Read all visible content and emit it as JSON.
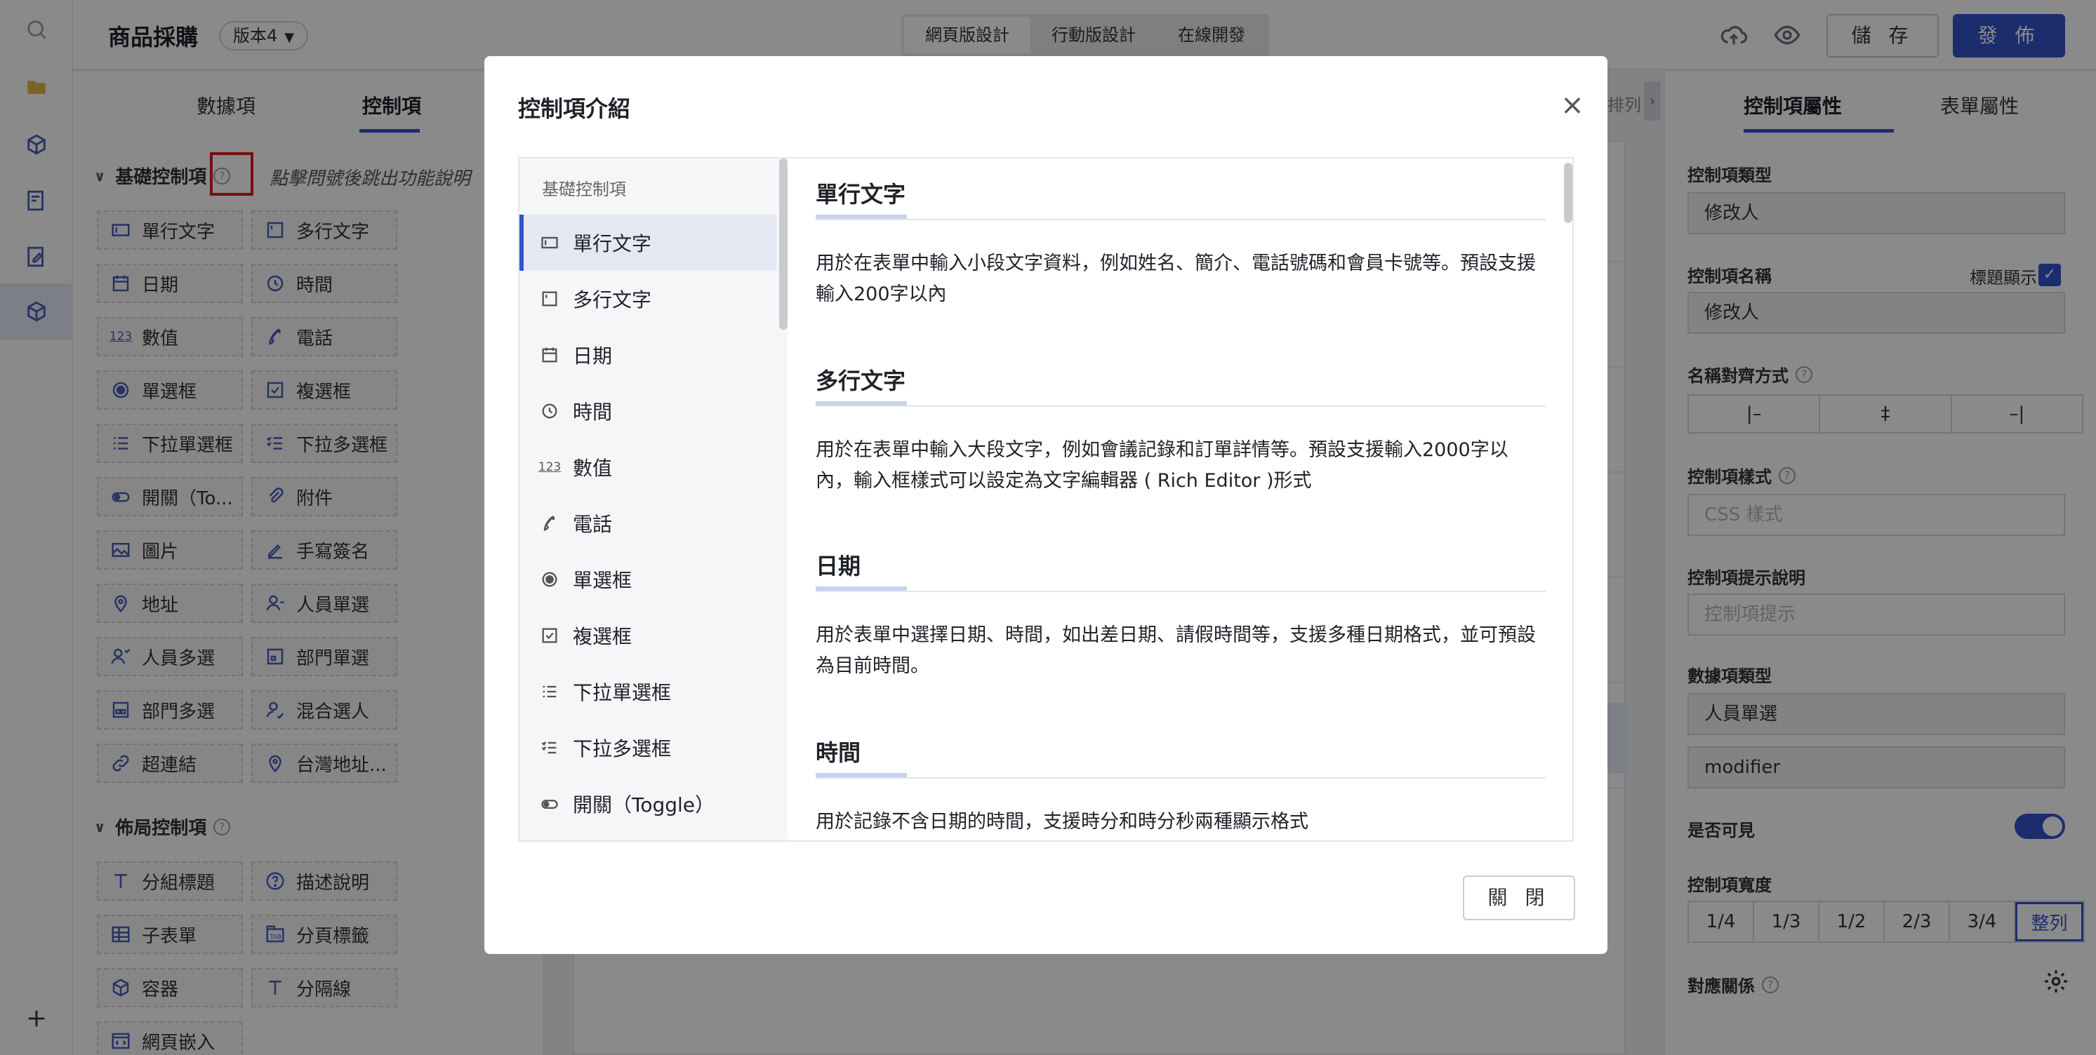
{
  "app": {
    "title": "商品採購",
    "version": "版本4",
    "modes": [
      "網頁版設計",
      "行動版設計",
      "在線開發"
    ],
    "save_label": "儲 存",
    "publish_label": "發 佈"
  },
  "left_panel": {
    "tabs": [
      "數據項",
      "控制項"
    ],
    "basic_header": "基礎控制項",
    "hint": "點擊問號後跳出功能說明",
    "basic_items": [
      {
        "label": "單行文字",
        "icon": "single-line-text-icon"
      },
      {
        "label": "多行文字",
        "icon": "multi-line-text-icon"
      },
      {
        "label": "日期",
        "icon": "calendar-icon"
      },
      {
        "label": "時間",
        "icon": "clock-icon"
      },
      {
        "label": "數值",
        "icon": "number-icon"
      },
      {
        "label": "電話",
        "icon": "phone-icon"
      },
      {
        "label": "單選框",
        "icon": "radio-icon"
      },
      {
        "label": "複選框",
        "icon": "checkbox-icon"
      },
      {
        "label": "下拉單選框",
        "icon": "dropdown-single-icon"
      },
      {
        "label": "下拉多選框",
        "icon": "dropdown-multi-icon"
      },
      {
        "label": "開關（To...",
        "icon": "toggle-icon"
      },
      {
        "label": "附件",
        "icon": "attachment-icon"
      },
      {
        "label": "圖片",
        "icon": "image-icon"
      },
      {
        "label": "手寫簽名",
        "icon": "signature-icon"
      },
      {
        "label": "地址",
        "icon": "location-icon"
      },
      {
        "label": "人員單選",
        "icon": "user-single-icon"
      },
      {
        "label": "人員多選",
        "icon": "users-multi-icon"
      },
      {
        "label": "部門單選",
        "icon": "dept-single-icon"
      },
      {
        "label": "部門多選",
        "icon": "dept-multi-icon"
      },
      {
        "label": "混合選人",
        "icon": "mixed-user-icon"
      },
      {
        "label": "超連結",
        "icon": "link-icon"
      },
      {
        "label": "台灣地址...",
        "icon": "tw-address-icon"
      }
    ],
    "layout_header": "佈局控制項",
    "layout_items": [
      {
        "label": "分組標題",
        "icon": "title-icon"
      },
      {
        "label": "描述說明",
        "icon": "help-icon"
      },
      {
        "label": "子表單",
        "icon": "table-icon"
      },
      {
        "label": "分頁標籤",
        "icon": "tab-icon"
      },
      {
        "label": "容器",
        "icon": "container-icon"
      },
      {
        "label": "分隔線",
        "icon": "divider-icon"
      },
      {
        "label": "網頁嵌入",
        "icon": "embed-icon"
      }
    ]
  },
  "canvas": {
    "partial_label": "排列"
  },
  "right_panel": {
    "tabs": [
      "控制項屬性",
      "表單屬性"
    ],
    "type_label": "控制項類型",
    "type_value": "修改人",
    "name_label": "控制項名稱",
    "name_value": "修改人",
    "show_title_label": "標題顯示",
    "align_label": "名稱對齊方式",
    "align_options": [
      "|–",
      "‡",
      "–|"
    ],
    "style_label": "控制項樣式",
    "style_placeholder": "CSS 樣式",
    "tip_label": "控制項提示說明",
    "tip_placeholder": "控制項提示",
    "data_type_label": "數據項類型",
    "data_type_value": "人員單選",
    "data_field_value": "modifier",
    "visible_label": "是否可見",
    "width_label": "控制項寬度",
    "width_options": [
      "1/4",
      "1/3",
      "1/2",
      "2/3",
      "3/4",
      "整列"
    ],
    "width_selected": "整列",
    "mapping_label": "對應關係"
  },
  "modal": {
    "title": "控制項介紹",
    "close_label": "關 閉",
    "nav_group": "基礎控制項",
    "nav_items": [
      {
        "label": "單行文字",
        "icon": "single-line-text-icon"
      },
      {
        "label": "多行文字",
        "icon": "multi-line-text-icon"
      },
      {
        "label": "日期",
        "icon": "calendar-icon"
      },
      {
        "label": "時間",
        "icon": "clock-icon"
      },
      {
        "label": "數值",
        "icon": "number-icon"
      },
      {
        "label": "電話",
        "icon": "phone-icon"
      },
      {
        "label": "單選框",
        "icon": "radio-icon"
      },
      {
        "label": "複選框",
        "icon": "checkbox-icon"
      },
      {
        "label": "下拉單選框",
        "icon": "dropdown-single-icon"
      },
      {
        "label": "下拉多選框",
        "icon": "dropdown-multi-icon"
      },
      {
        "label": "開關（Toggle）",
        "icon": "toggle-icon"
      }
    ],
    "sections": [
      {
        "title": "單行文字",
        "text": "用於在表單中輸入小段文字資料，例如姓名、簡介、電話號碼和會員卡號等。預設支援輸入200字以內"
      },
      {
        "title": "多行文字",
        "text": "用於在表單中輸入大段文字，例如會議記錄和訂單詳情等。預設支援輸入2000字以內，輸入框樣式可以設定為文字編輯器 ( Rich Editor )形式"
      },
      {
        "title": "日期",
        "text": "用於表單中選擇日期、時間，如出差日期、請假時間等，支援多種日期格式，並可預設為目前時間。"
      },
      {
        "title": "時間",
        "text": "用於記錄不含日期的時間，支援時分和時分秒兩種顯示格式"
      }
    ]
  }
}
